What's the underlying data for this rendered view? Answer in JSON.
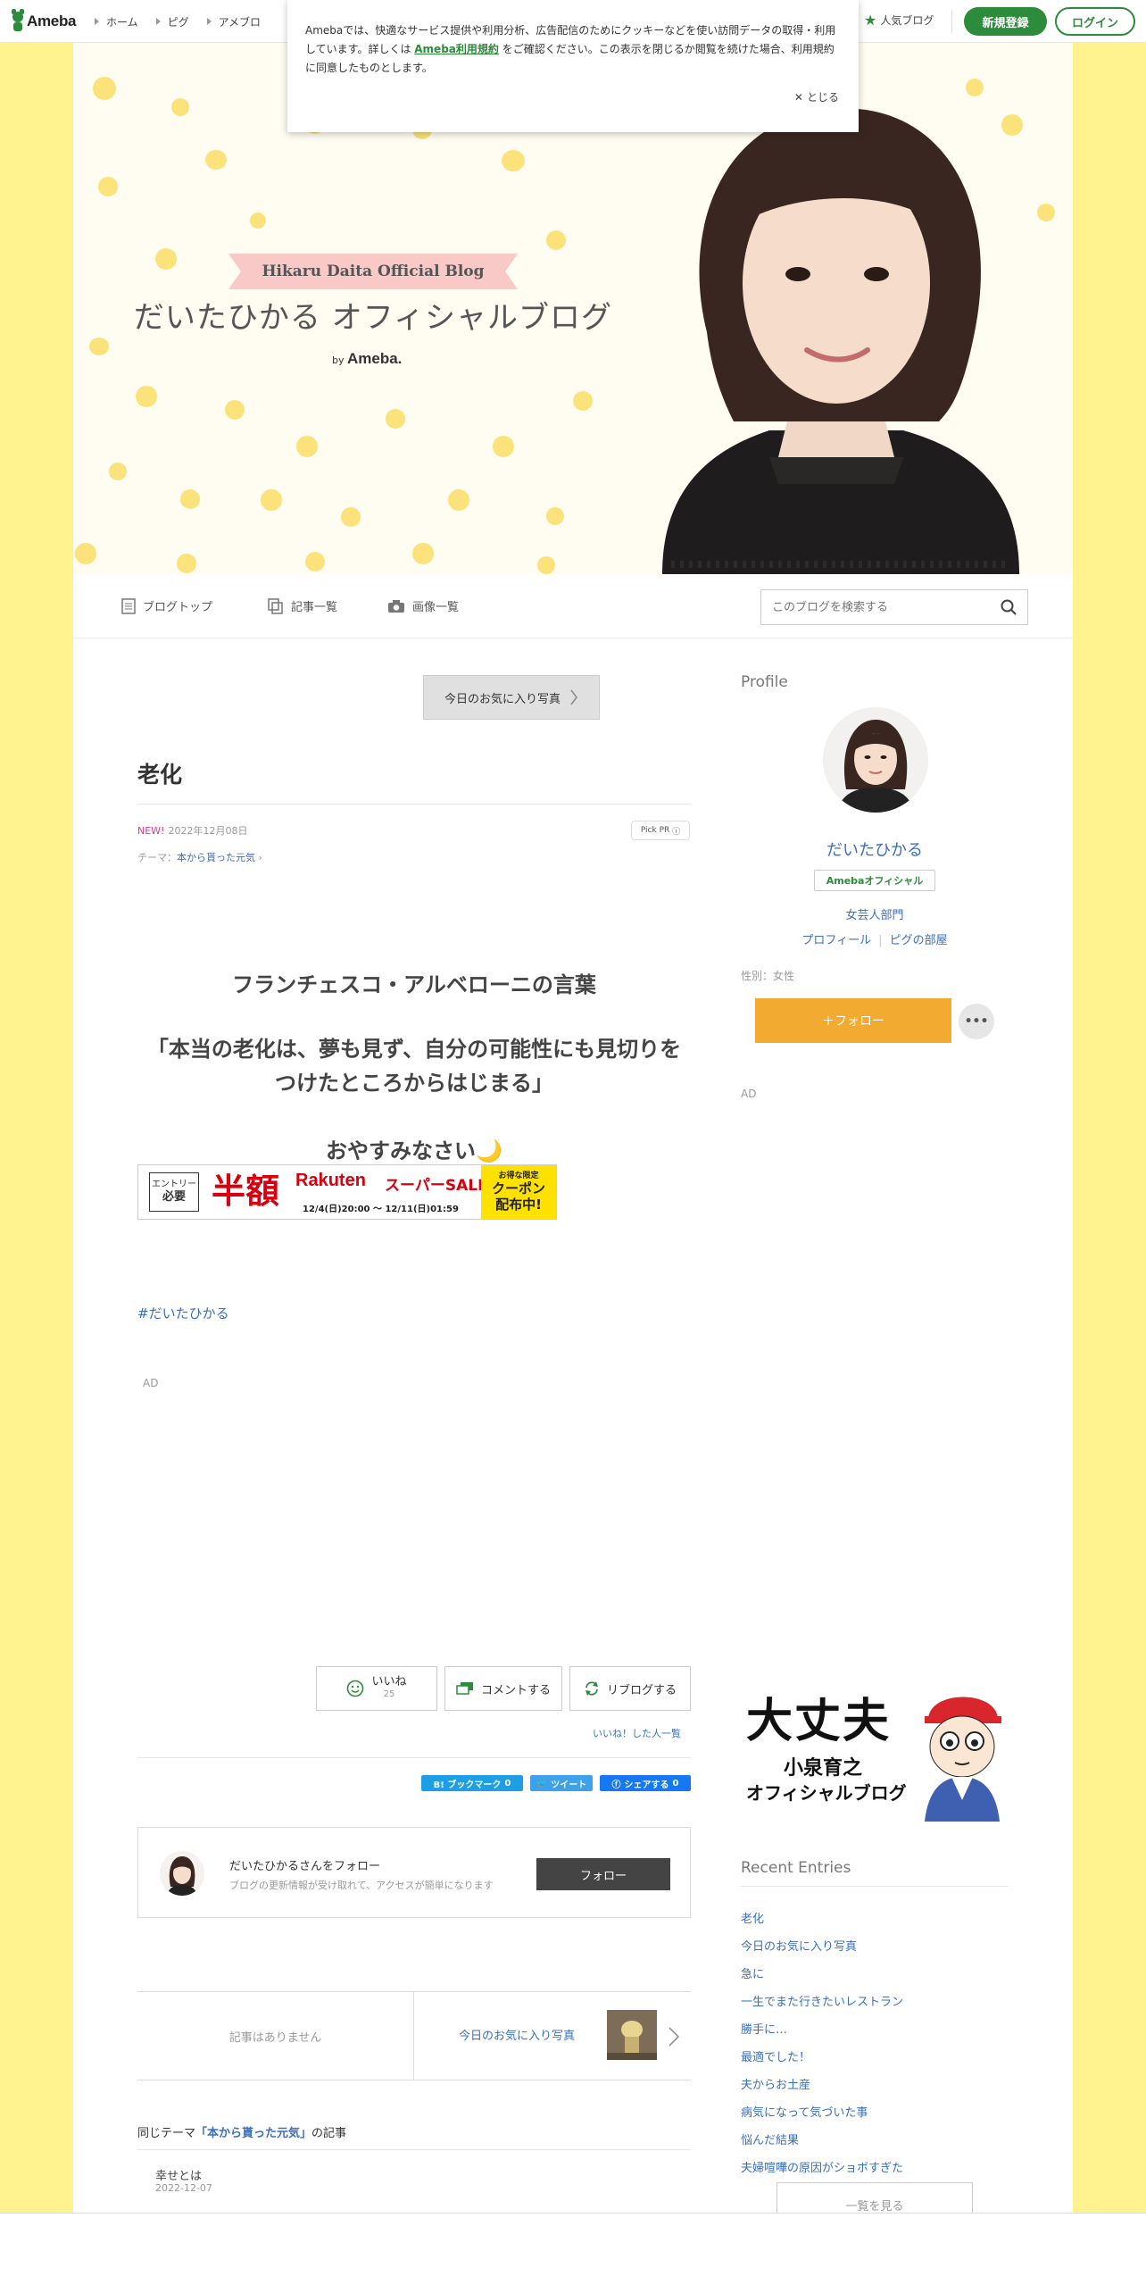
{
  "topbar": {
    "logo_text": "Ameba",
    "nav": [
      "ホーム",
      "ピグ",
      "アメブロ"
    ],
    "popular_label": "人気ブログ",
    "register_label": "新規登録",
    "login_label": "ログイン"
  },
  "cookie": {
    "text_before": "Amebaでは、快適なサービス提供や利用分析、広告配信のためにクッキーなどを使い訪問データの取得・利用しています。詳しくは ",
    "terms_link": "Ameba利用規約",
    "text_after": " をご確認ください。この表示を閉じるか閲覧を続けた場合、利用規約に同意したものとします。",
    "close_label": "とじる"
  },
  "header": {
    "ribbon": "Hikaru Daita Official Blog",
    "title": "だいたひかる オフィシャルブログ",
    "by": "by",
    "brand": "Ameba."
  },
  "blognav": {
    "items": [
      "ブログトップ",
      "記事一覧",
      "画像一覧"
    ],
    "search_placeholder": "このブログを検索する"
  },
  "article": {
    "prev_label": "今日のお気に入り写真",
    "title": "老化",
    "new_badge": "NEW!",
    "date": "2022年12月08日",
    "pickpr": "Pick PR",
    "theme_prefix": "テーマ：",
    "theme": "本から貰った元気",
    "body": [
      "フランチェスコ・アルベローニの言葉",
      "「本当の老化は、夢も見ず、自分の可能性にも見切りを",
      "つけたところからはじまる」",
      "おやすみなさい🌙"
    ],
    "ad_rakuten": {
      "entry_top": "エントリー",
      "entry_bottom": "必要",
      "half": "半額",
      "brand": "Rakuten",
      "sale": "スーパーSALE",
      "period": "12/4(日)20:00 〜 12/11(日)01:59",
      "coupon1": "お得な限定",
      "coupon2": "クーポン",
      "coupon3": "配布中!"
    },
    "hashtag": "#だいたひかる",
    "ad_label": "AD"
  },
  "actions": {
    "like_label": "いいね",
    "like_count": "25",
    "comment_label": "コメントする",
    "reblog_label": "リブログする",
    "liked_list": "いいね！した人一覧"
  },
  "share": {
    "hatena": "B! ブックマーク",
    "hatena_count": "0",
    "tweet": "ツイート",
    "fb": "シェアする",
    "fb_count": "0"
  },
  "follow_box": {
    "title": "だいたひかるさんをフォロー",
    "subtitle": "ブログの更新情報が受け取れて、アクセスが簡単になります",
    "button": "フォロー"
  },
  "pager": {
    "prev_none": "記事はありません",
    "next_label": "今日のお気に入り写真"
  },
  "same_theme": {
    "prefix": "同じテーマ",
    "theme": "「本から貰った元気」",
    "suffix": "の記事",
    "item_title": "幸せとは",
    "item_date": "2022-12-07"
  },
  "sidebar": {
    "profile_heading": "Profile",
    "name": "だいたひかる",
    "official_badge": "Amebaオフィシャル",
    "category": "女芸人部門",
    "link_profile": "プロフィール",
    "link_pig": "ピグの部屋",
    "gender": "性別：女性",
    "follow_label": "＋フォロー",
    "more_label": "•••",
    "ad_label": "AD",
    "banner_line1": "大丈夫",
    "banner_line2": "小泉育之",
    "banner_line3": "オフィシャルブログ",
    "recent_heading": "Recent Entries",
    "recent": [
      "老化",
      "今日のお気に入り写真",
      "急に",
      "一生でまた行きたいレストラン",
      "勝手に…",
      "最適でした！",
      "夫からお土産",
      "病気になって気づいた事",
      "悩んだ結果",
      "夫婦喧嘩の原因がショボすぎた"
    ],
    "see_all": "一覧を見る"
  },
  "colors": {
    "page_bg": "#fff38f",
    "ameba_green": "#2d8c3c",
    "link_blue": "#3a6fbf",
    "follow_orange": "#f2ab30"
  }
}
